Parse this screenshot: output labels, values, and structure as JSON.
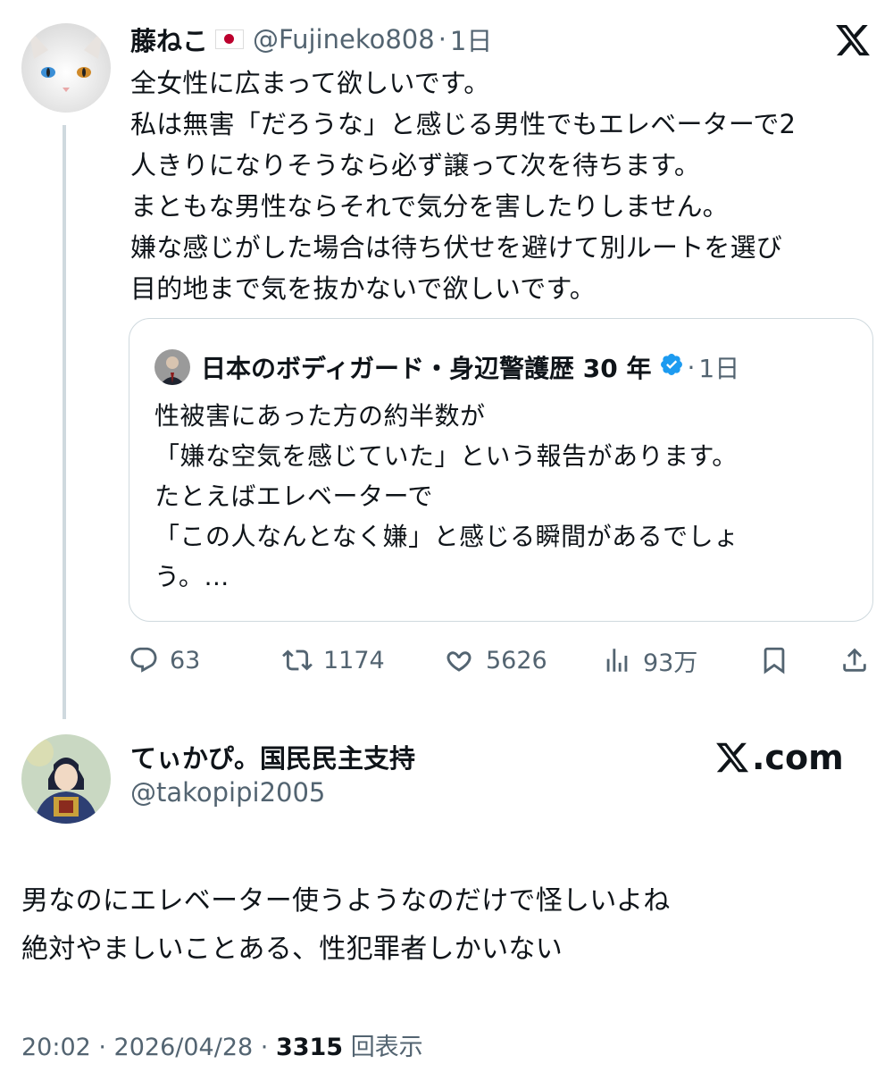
{
  "original_tweet": {
    "display_name": "藤ねこ",
    "handle": "@Fujineko808",
    "separator": "·",
    "time": "1日",
    "lines": "全女性に広まって欲しいです。\n私は無害「だろうな」と感じる男性でもエレベーターで2\n人きりになりそうなら必ず譲って次を待ちます。\nまともな男性ならそれで気分を害したりしません。\n嫌な感じがした場合は待ち伏せを避けて別ルートを選び\n目的地まで気を抜かないで欲しいです。",
    "quoted": {
      "display_name": "日本のボディガード・身辺警護歴 30 年",
      "separator": "·",
      "time": "1日",
      "text": "性被害にあった方の約半数が\n「嫌な空気を感じていた」という報告があります。\nたとえばエレベーターで\n「この人なんとなく嫌」と感じる瞬間があるでしょ\nう。…"
    },
    "actions": {
      "replies": "63",
      "reposts": "1174",
      "likes": "5626",
      "views": "93万"
    }
  },
  "reply_tweet": {
    "display_name": "てぃかぴ。国民民主支持",
    "handle": "@takopipi2005",
    "brand": ".com",
    "text": "男なのにエレベーター使うようなのだけで怪しいよね\n絶対やましいことある、性犯罪者しかいない",
    "timestamp": "20:02 · 2026/04/28 · ",
    "views_count": "3315",
    "views_label": "回表示"
  },
  "colors": {
    "text": "#0f1419",
    "muted": "#536471",
    "border": "#cfd9de",
    "verified": "#1d9bf0"
  },
  "icons": [
    "x-logo-icon",
    "reply-icon",
    "repost-icon",
    "like-icon",
    "views-icon",
    "bookmark-icon",
    "share-icon",
    "verified-badge-icon"
  ]
}
